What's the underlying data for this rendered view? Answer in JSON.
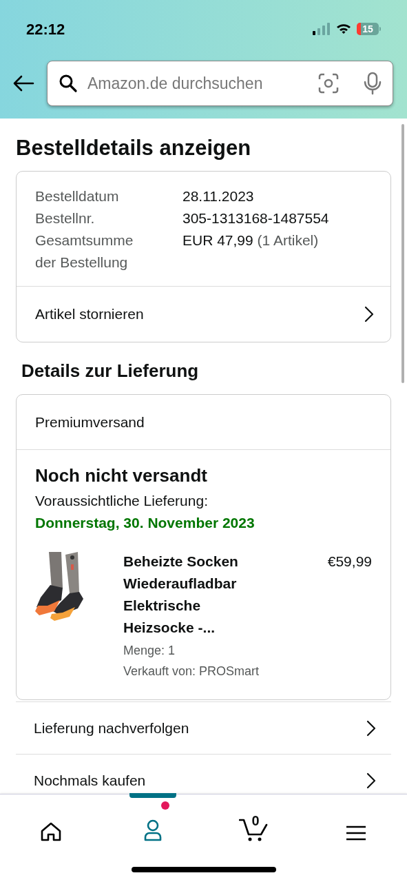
{
  "status_bar": {
    "time": "22:12",
    "battery": "15"
  },
  "search": {
    "placeholder": "Amazon.de durchsuchen"
  },
  "page_title": "Bestelldetails anzeigen",
  "order_summary": {
    "rows": [
      {
        "label": "Bestelldatum",
        "value": "28.11.2023"
      },
      {
        "label": "Bestellnr.",
        "value": "305-1313168-1487554"
      },
      {
        "label": "Gesamtsumme der Bestellung",
        "value": "EUR 47,99",
        "note": "(1 Artikel)"
      }
    ],
    "action": "Artikel stornieren"
  },
  "delivery_heading": "Details zur Lieferung",
  "shipment": {
    "method": "Premiumversand",
    "status": "Noch nicht versandt",
    "expected_label": "Voraussichtliche Lieferung:",
    "expected_date": "Donnerstag, 30. November 2023",
    "item": {
      "kind": "picture",
      "title": "Beheizte Socken Wiederaufladbar Elektrische Heizsocke -...",
      "price": "€59,99",
      "quantity": "Menge: 1",
      "seller": "Verkauft von: PROSmart"
    }
  },
  "actions": [
    "Lieferung nachverfolgen",
    "Nochmals kaufen"
  ],
  "bottom_nav": [
    {
      "kind": "home",
      "selected": false
    },
    {
      "kind": "account",
      "selected": true,
      "badge": true
    },
    {
      "kind": "cart",
      "selected": false,
      "count": "0"
    },
    {
      "kind": "menu",
      "selected": false
    }
  ]
}
